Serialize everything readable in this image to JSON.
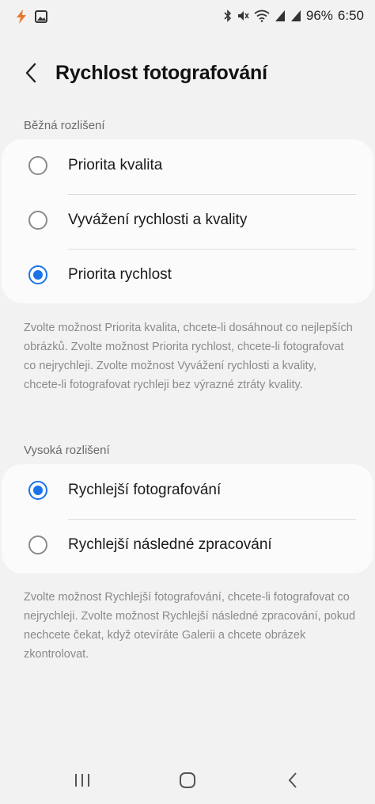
{
  "status_bar": {
    "battery": "96%",
    "time": "6:50",
    "icons": [
      "flash-icon",
      "gallery-icon",
      "bluetooth-icon",
      "mute-icon",
      "wifi-icon",
      "signal-icon",
      "signal-icon"
    ]
  },
  "header": {
    "back_icon": "chevron-left-icon",
    "title": "Rychlost fotografování"
  },
  "standard_resolution": {
    "label": "Běžná rozlišení",
    "options": [
      {
        "label": "Priorita kvalita",
        "selected": false
      },
      {
        "label": "Vyvážení rychlosti a kvality",
        "selected": false
      },
      {
        "label": "Priorita rychlost",
        "selected": true
      }
    ],
    "description": "Zvolte možnost Priorita kvalita, chcete-li dosáhnout co nejlepších obrázků. Zvolte možnost Priorita rychlost, chcete-li fotografovat co nejrychleji. Zvolte možnost Vyvážení rychlosti a kvality, chcete-li fotografovat rychleji bez výrazné ztráty kvality."
  },
  "high_resolution": {
    "label": "Vysoká rozlišení",
    "options": [
      {
        "label": "Rychlejší fotografování",
        "selected": true
      },
      {
        "label": "Rychlejší následné zpracování",
        "selected": false
      }
    ],
    "description": "Zvolte možnost Rychlejší fotografování, chcete-li fotografovat co nejrychleji. Zvolte možnost Rychlejší následné zpracování, pokud nechcete čekat, když otevíráte Galerii a chcete obrázek zkontrolovat."
  },
  "nav_bar": {
    "icons": [
      "recents-icon",
      "home-icon",
      "back-icon"
    ]
  },
  "colors": {
    "accent": "#1a73e8",
    "background": "#f2f2f2",
    "card": "#fbfbfb"
  }
}
